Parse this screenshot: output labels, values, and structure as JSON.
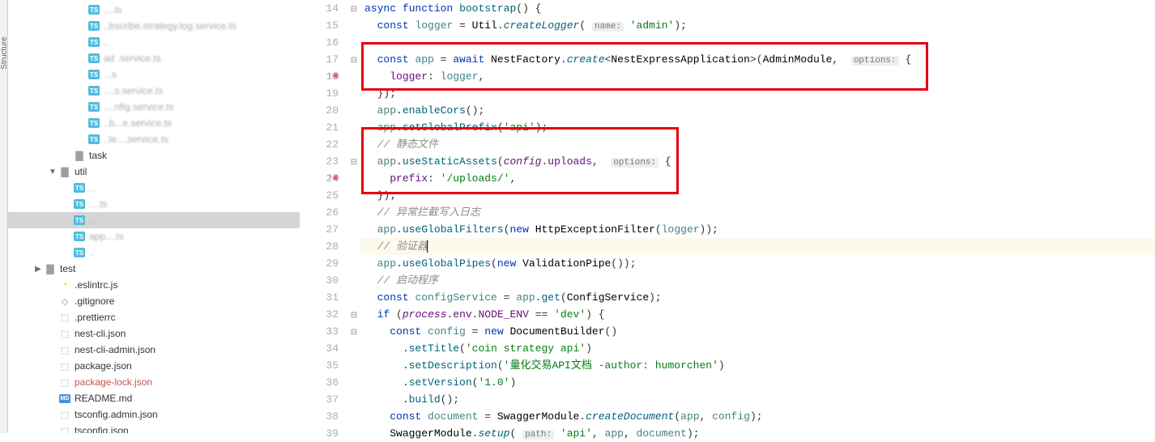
{
  "sidebar_tab": "Structure",
  "tree": {
    "items": [
      {
        "indent": 4,
        "icon": "ts",
        "label": "....ts",
        "blur": true
      },
      {
        "indent": 4,
        "icon": "ts",
        "label": "..bscribe.strategy.log.service.ts",
        "blur": true
      },
      {
        "indent": 4,
        "icon": "ts",
        "label": "..",
        "blur": true
      },
      {
        "indent": 4,
        "icon": "ts",
        "label": "ad .service.ts",
        "blur": true
      },
      {
        "indent": 4,
        "icon": "ts",
        "label": "...s",
        "blur": true
      },
      {
        "indent": 4,
        "icon": "ts",
        "label": "....s.service.ts",
        "blur": true
      },
      {
        "indent": 4,
        "icon": "ts",
        "label": "....nfig.service.ts",
        "blur": true
      },
      {
        "indent": 4,
        "icon": "ts",
        "label": "..b...e.service.ts",
        "blur": true
      },
      {
        "indent": 4,
        "icon": "ts",
        "label": "..le....service.ts",
        "blur": true
      },
      {
        "indent": 3,
        "icon": "folder",
        "label": "task"
      },
      {
        "indent": 2,
        "icon": "folder",
        "label": "util",
        "arrow": "down"
      },
      {
        "indent": 3,
        "icon": "ts",
        "label": "...",
        "blur": true
      },
      {
        "indent": 3,
        "icon": "ts",
        "label": "....ts",
        "blur": true
      },
      {
        "indent": 3,
        "icon": "ts",
        "label": "...",
        "blur": true,
        "selected": true
      },
      {
        "indent": 3,
        "icon": "ts",
        "label": "app....ts",
        "blur": true
      },
      {
        "indent": 3,
        "icon": "ts",
        "label": "..",
        "blur": true
      },
      {
        "indent": 1,
        "icon": "folder",
        "label": "test",
        "arrow": "right"
      },
      {
        "indent": 2,
        "icon": "js",
        "label": ".eslintrc.js"
      },
      {
        "indent": 2,
        "icon": "git",
        "label": ".gitignore"
      },
      {
        "indent": 2,
        "icon": "json",
        "label": ".prettierrc"
      },
      {
        "indent": 2,
        "icon": "json",
        "label": "nest-cli.json"
      },
      {
        "indent": 2,
        "icon": "json",
        "label": "nest-cli-admin.json"
      },
      {
        "indent": 2,
        "icon": "json",
        "label": "package.json"
      },
      {
        "indent": 2,
        "icon": "json",
        "label": "package-lock.json",
        "vcs": true
      },
      {
        "indent": 2,
        "icon": "md",
        "label": "README.md"
      },
      {
        "indent": 2,
        "icon": "json",
        "label": "tsconfig.admin.json"
      },
      {
        "indent": 2,
        "icon": "json",
        "label": "tsconfig.json"
      }
    ]
  },
  "gutter": {
    "lines": [
      14,
      15,
      16,
      17,
      18,
      19,
      20,
      21,
      22,
      23,
      24,
      25,
      26,
      27,
      28,
      29,
      30,
      31,
      32,
      33,
      34,
      35,
      36,
      37,
      38,
      39
    ],
    "marks": {
      "18": "↑",
      "24": "↑"
    },
    "folds": {
      "14": "-",
      "17": "-",
      "23": "-",
      "32": "-",
      "33": "-"
    }
  },
  "code": {
    "l14": {
      "k_async": "async",
      "k_function": "function",
      "fn": "bootstrap",
      "suf": "() {"
    },
    "l15": {
      "indent": "  ",
      "kw": "const",
      "v": "logger",
      "eq": " = ",
      "obj": "Util",
      "call": "createLogger",
      "hint": "name:",
      "str": "'admin'"
    },
    "l17": {
      "indent": "  ",
      "kw": "const",
      "v": "app",
      "eq": " = ",
      "aw": "await",
      "obj": "NestFactory",
      "call": "create",
      "gen": "NestExpressApplication",
      "arg": "AdminModule",
      "hint": "options:",
      "brace": " {"
    },
    "l18": {
      "indent": "    ",
      "prop": "logger",
      "val": "logger"
    },
    "l19": {
      "indent": "  ",
      "txt": "});"
    },
    "l20": {
      "indent": "  ",
      "obj": "app",
      "call": "enableCors",
      "suf": "();"
    },
    "l21": {
      "indent": "  ",
      "obj": "app",
      "call": "setGlobalPrefix",
      "str": "'api'"
    },
    "l22": {
      "indent": "  ",
      "cmt": "// 静态文件"
    },
    "l23": {
      "indent": "  ",
      "obj": "app",
      "call": "useStaticAssets",
      "arg1": "config",
      "arg1p": "uploads",
      "hint": "options:",
      "brace": " {"
    },
    "l24": {
      "indent": "    ",
      "prop": "prefix",
      "str": "'/uploads/'"
    },
    "l25": {
      "indent": "  ",
      "txt": "});"
    },
    "l26": {
      "indent": "  ",
      "cmt": "// 异常拦截写入日志"
    },
    "l27": {
      "indent": "  ",
      "obj": "app",
      "call": "useGlobalFilters",
      "kw": "new",
      "cls": "HttpExceptionFilter",
      "arg": "logger"
    },
    "l28": {
      "indent": "  ",
      "cmt": "// 验证器"
    },
    "l29": {
      "indent": "  ",
      "obj": "app",
      "call": "useGlobalPipes",
      "kw": "new",
      "cls": "ValidationPipe"
    },
    "l30": {
      "indent": "  ",
      "cmt": "// 启动程序"
    },
    "l31": {
      "indent": "  ",
      "kw": "const",
      "v": "configService",
      "eq": " = ",
      "obj": "app",
      "call": "get",
      "arg": "ConfigService"
    },
    "l32": {
      "indent": "  ",
      "kw": "if",
      "paren": "(",
      "obj": "process",
      "prop1": "env",
      "prop2": "NODE_ENV",
      "op": " == ",
      "str": "'dev'",
      "suf": ") {"
    },
    "l33": {
      "indent": "    ",
      "kw": "const",
      "v": "config",
      "eq": " = ",
      "new": "new",
      "cls": "DocumentBuilder",
      "suf": "()"
    },
    "l34": {
      "indent": "      ",
      "call": "setTitle",
      "str": "'coin strategy api'"
    },
    "l35": {
      "indent": "      ",
      "call": "setDescription",
      "str": "'量化交易API文档 -author: humorchen'"
    },
    "l36": {
      "indent": "      ",
      "call": "setVersion",
      "str": "'1.0'"
    },
    "l37": {
      "indent": "      ",
      "call": "build",
      "suf": "();"
    },
    "l38": {
      "indent": "    ",
      "kw": "const",
      "v": "document",
      "eq": " = ",
      "obj": "SwaggerModule",
      "call": "createDocument",
      "arg1": "app",
      "arg2": "config"
    },
    "l39": {
      "indent": "    ",
      "obj": "SwaggerModule",
      "call": "setup",
      "hint": "path:",
      "str": "'api'",
      "arg1": "app",
      "arg2": "document"
    }
  }
}
